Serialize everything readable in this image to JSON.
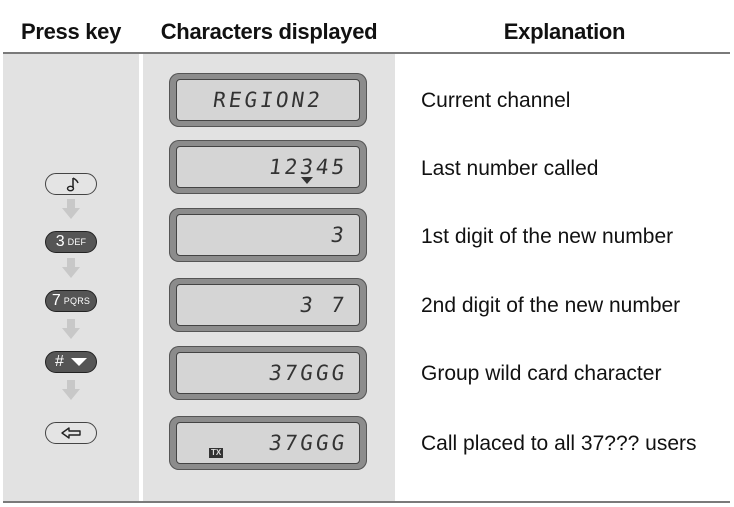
{
  "headers": {
    "press_key": "Press key",
    "characters_displayed": "Characters displayed",
    "explanation": "Explanation"
  },
  "rows": [
    {
      "key": "",
      "key_icon": "none",
      "display": "REGION2",
      "indicator": "",
      "explanation": "Current channel"
    },
    {
      "key": "",
      "key_icon": "music-note-icon",
      "display": "12345",
      "indicator": "triangle",
      "explanation": "Last number called"
    },
    {
      "key_main": "3",
      "key_sub": "DEF",
      "key_icon": "key-3-def-icon",
      "display": "3",
      "indicator": "",
      "explanation": "1st digit of the new number"
    },
    {
      "key_main": "7",
      "key_sub": "PQRS",
      "key_icon": "key-7-pqrs-icon",
      "display": "3 7",
      "indicator": "",
      "explanation": "2nd digit of the new number"
    },
    {
      "key_main": "#",
      "key_sub": "",
      "key_icon": "hash-down-key-icon",
      "display": "37GGG",
      "indicator": "",
      "explanation": "Group wild card character"
    },
    {
      "key": "",
      "key_icon": "enter-key-icon",
      "display": "37GGG",
      "indicator": "TX",
      "explanation": "Call placed to all 37??? users"
    }
  ],
  "colors": {
    "column_bg": "#e2e2e2",
    "key_dark": "#555555",
    "arrow": "#c8c8c8"
  }
}
